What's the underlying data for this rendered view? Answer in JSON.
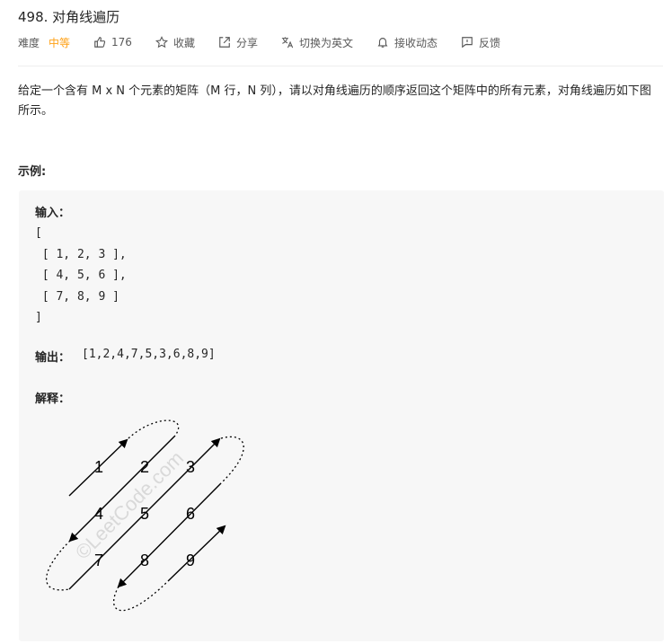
{
  "problem": {
    "title": "498. 对角线遍历",
    "difficulty_label": "难度",
    "difficulty_value": "中等",
    "likes": "176",
    "collect_label": "收藏",
    "share_label": "分享",
    "translate_label": "切换为英文",
    "subscribe_label": "接收动态",
    "feedback_label": "反馈"
  },
  "description": "给定一个含有 M x N 个元素的矩阵（M 行，N 列），请以对角线遍历的顺序返回这个矩阵中的所有元素，对角线遍历如下图所示。",
  "example": {
    "heading": "示例:",
    "input_label": "输入：",
    "input_lines": "[\n [ 1, 2, 3 ],\n [ 4, 5, 6 ],\n [ 7, 8, 9 ]\n]",
    "output_label": "输出：",
    "output_value": "[1,2,4,7,5,3,6,8,9]",
    "explain_label": "解释：",
    "diagram": {
      "numbers": [
        "1",
        "2",
        "3",
        "4",
        "5",
        "6",
        "7",
        "8",
        "9"
      ],
      "watermark": "©LeetCode.com"
    }
  },
  "icons": {
    "like": "thumbs-up-icon",
    "collect": "star-icon",
    "share": "share-icon",
    "translate": "translate-icon",
    "subscribe": "bell-icon",
    "feedback": "feedback-icon"
  },
  "colors": {
    "accent": "#ffa116",
    "text": "#262626",
    "muted": "#595959",
    "box_bg": "#f7f7f7"
  }
}
